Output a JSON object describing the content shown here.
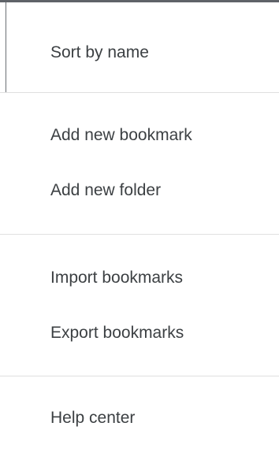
{
  "menu": {
    "items": [
      {
        "label": "Sort by name"
      },
      {
        "label": "Add new bookmark"
      },
      {
        "label": "Add new folder"
      },
      {
        "label": "Import bookmarks"
      },
      {
        "label": "Export bookmarks"
      },
      {
        "label": "Help center"
      }
    ]
  }
}
